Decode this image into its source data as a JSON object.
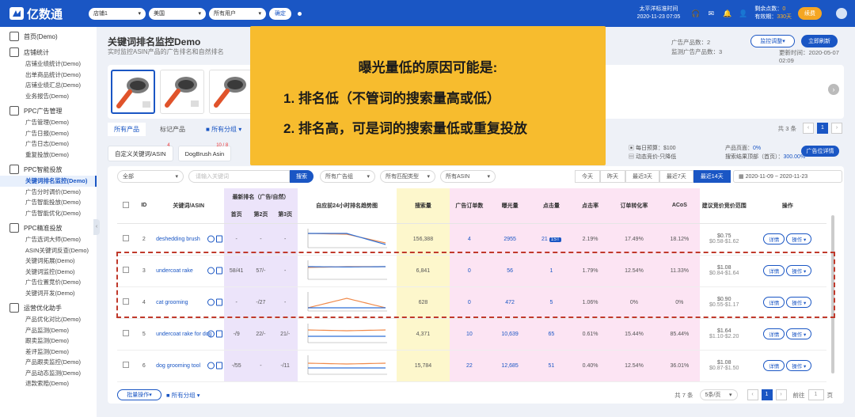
{
  "topbar": {
    "logo": "亿数通",
    "logo_sup": "®",
    "shop_select": "店铺1",
    "country_select": "美国",
    "user_select": "所有用户",
    "confirm_btn": "确定",
    "timezone_label": "太平洋标准时间",
    "timezone_time": "2020-11-23 07:05",
    "points_label": "剩余点数：",
    "points_value": "0",
    "days_label": "有效期：",
    "days_value": "330天",
    "renew_btn": "续费"
  },
  "sidebar": {
    "items": [
      {
        "type": "top",
        "label": "首页(Demo)",
        "icon": "home-icon"
      },
      {
        "type": "top",
        "label": "店铺统计",
        "icon": "store-icon"
      },
      {
        "type": "sub",
        "label": "店铺业绩统计(Demo)"
      },
      {
        "type": "sub",
        "label": "出单商品统计(Demo)"
      },
      {
        "type": "sub",
        "label": "店铺业绩汇总(Demo)"
      },
      {
        "type": "sub",
        "label": "业务报告(Demo)"
      },
      {
        "type": "top",
        "label": "PPC广告管理",
        "icon": "ppc-icon"
      },
      {
        "type": "sub",
        "label": "广告管理(Demo)"
      },
      {
        "type": "sub",
        "label": "广告日报(Demo)"
      },
      {
        "type": "sub",
        "label": "广告日志(Demo)"
      },
      {
        "type": "sub",
        "label": "重复投放(Demo)"
      },
      {
        "type": "top",
        "label": "PPC智能投放",
        "icon": "ai-icon"
      },
      {
        "type": "sub",
        "label": "关键词排名监控(Demo)",
        "active": true
      },
      {
        "type": "sub",
        "label": "广告分时调价(Demo)"
      },
      {
        "type": "sub",
        "label": "广告智能投放(Demo)"
      },
      {
        "type": "sub",
        "label": "广告智能优化(Demo)"
      },
      {
        "type": "top",
        "label": "PPC精准投放",
        "icon": "target-icon"
      },
      {
        "type": "sub",
        "label": "广告选词大师(Demo)"
      },
      {
        "type": "sub",
        "label": "ASIN关键词反查(Demo)"
      },
      {
        "type": "sub",
        "label": "关键词拓展(Demo)"
      },
      {
        "type": "sub",
        "label": "关键词监控(Demo)"
      },
      {
        "type": "sub",
        "label": "广告位置竞价(Demo)"
      },
      {
        "type": "sub",
        "label": "关键词开发(Demo)"
      },
      {
        "type": "top",
        "label": "运营优化助手",
        "icon": "assistant-icon"
      },
      {
        "type": "sub",
        "label": "产品优化对比(Demo)"
      },
      {
        "type": "sub",
        "label": "产品监测(Demo)"
      },
      {
        "type": "sub",
        "label": "跟卖监测(Demo)"
      },
      {
        "type": "sub",
        "label": "差评监测(Demo)"
      },
      {
        "type": "sub",
        "label": "产品跟卖监控(Demo)"
      },
      {
        "type": "sub",
        "label": "产品动态监测(Demo)"
      },
      {
        "type": "sub",
        "label": "退款索赔(Demo)"
      }
    ]
  },
  "header": {
    "title": "关键词排名监控Demo",
    "subtitle": "实时监控ASIN产品的广告排名和自然排名",
    "ad_count_label": "广告产品数：",
    "ad_count": "2",
    "monitor_count_label": "监测广告产品数：",
    "monitor_count": "3",
    "update_label": "更新时间：",
    "update_time": "2020-05-07 02:09",
    "monitor_btn": "监控调整",
    "refresh_btn": "立即刷新"
  },
  "tabs": {
    "all": "所有产品",
    "marked": "标记产品",
    "groups": "所有分组",
    "total": "共 3 条"
  },
  "kwtabs": {
    "t1": "自定义关键词/ASIN",
    "t1_badge": "4",
    "t2": "DogBrush Asin",
    "t2_badge": "10 / 8"
  },
  "budget": {
    "daily_label": "每日预算：",
    "daily": "$100",
    "dynamic": "动态竞价-只降低",
    "remaining": "只剩 × 任 14:53"
  },
  "pagecfg": {
    "label": "产品页面：",
    "value": "0%",
    "top_label": "搜索结果顶部（首页）：",
    "top_value": "300.00%",
    "btn": "广告位详情"
  },
  "filters": {
    "all": "全部",
    "search_placeholder": "请输入关键词",
    "search_btn": "搜索",
    "ad_group": "所有广告组",
    "match": "所有匹配类型",
    "asin": "所有ASIN"
  },
  "date_tabs": [
    "今天",
    "昨天",
    "最近3天",
    "最近7天",
    "最近14天"
  ],
  "date_active": 4,
  "date_range": {
    "from": "2020-11-09",
    "sep": "~",
    "to": "2020-11-23"
  },
  "table": {
    "headers": {
      "id": "ID",
      "keyword": "关键词/ASIN",
      "rank": "最新排名（广告/自然）",
      "p1": "首页",
      "p2": "第2页",
      "p3": "第3页",
      "trend": "自应前24小时排名趋势图",
      "search": "搜索量",
      "orders": "广告订单数",
      "impressions": "曝光量",
      "clicks": "点击量",
      "ctr": "点击率",
      "cvr": "订单转化率",
      "acos": "ACoS",
      "bid": "建议竞价竞价范围",
      "ops": "操作"
    },
    "rows": [
      {
        "id": "2",
        "kw": "deshedding brush",
        "p1": "-",
        "p2": "-",
        "p3": "-",
        "search": "156,388",
        "orders": "4",
        "impr": "2955",
        "clicks": "21",
        "clicks_badge": "1ST",
        "ctr": "2.19%",
        "cvr": "17.49%",
        "acos": "18.12%",
        "bid1": "$0.75",
        "bid2": "$0.58-$1.62",
        "trend": [
          [
            0.2,
            0.25,
            0.8
          ],
          [
            0.2,
            0.2,
            0.9
          ]
        ]
      },
      {
        "id": "3",
        "kw": "undercoat rake",
        "p1": "58/41",
        "p2": "57/-",
        "p3": "-",
        "search": "6,841",
        "orders": "0",
        "impr": "56",
        "clicks": "1",
        "ctr": "1.79%",
        "cvr": "12.54%",
        "acos": "11.33%",
        "bid1": "$1.08",
        "bid2": "$0.84-$1.64",
        "trend": [
          [
            0.35,
            0.3,
            0.3
          ],
          [
            0.3,
            0.32,
            0.3
          ]
        ]
      },
      {
        "id": "4",
        "kw": "cat grooming",
        "p1": "-",
        "p2": "-/27",
        "p3": "-",
        "search": "628",
        "orders": "0",
        "impr": "472",
        "clicks": "5",
        "ctr": "1.06%",
        "cvr": "0%",
        "acos": "0%",
        "bid1": "$0.90",
        "bid2": "$0.55-$1.17",
        "trend": [
          [
            0.9,
            0.3,
            0.9
          ],
          [
            0.9,
            0.9,
            0.9
          ]
        ]
      },
      {
        "id": "5",
        "kw": "undercoat rake for dog",
        "p1": "-/9",
        "p2": "22/-",
        "p3": "21/-",
        "search": "4,371",
        "orders": "10",
        "impr": "10,639",
        "clicks": "65",
        "ctr": "0.61%",
        "cvr": "15.44%",
        "acos": "85.44%",
        "bid1": "$1.64",
        "bid2": "$1.10-$2.20",
        "trend": [
          [
            0.3,
            0.35,
            0.3
          ],
          [
            0.7,
            0.7,
            0.7
          ]
        ]
      },
      {
        "id": "6",
        "kw": "dog grooming tool",
        "p1": "-/55",
        "p2": "-",
        "p3": "-/11",
        "search": "15,784",
        "orders": "22",
        "impr": "12,685",
        "clicks": "51",
        "ctr": "0.40%",
        "cvr": "12.54%",
        "acos": "36.01%",
        "bid1": "$1.08",
        "bid2": "$0.87-$1.50",
        "trend": [
          [
            0.4,
            0.45,
            0.4
          ],
          [
            0.7,
            0.7,
            0.7
          ]
        ]
      }
    ],
    "detail_btn": "详情",
    "op_btn": "操作"
  },
  "footer": {
    "batch": "批量操作",
    "groups": "所有分组",
    "total": "共 7 条",
    "page_size": "5条/页",
    "page": "1",
    "goto": "前往",
    "goto_page": "1",
    "page_unit": "页"
  },
  "overlay": {
    "title": "曝光量低的原因可能是:",
    "line1": "1.  排名低（不管词的搜索量高或低）",
    "line2": "2.  排名高，可是词的搜索量低或重复投放"
  }
}
